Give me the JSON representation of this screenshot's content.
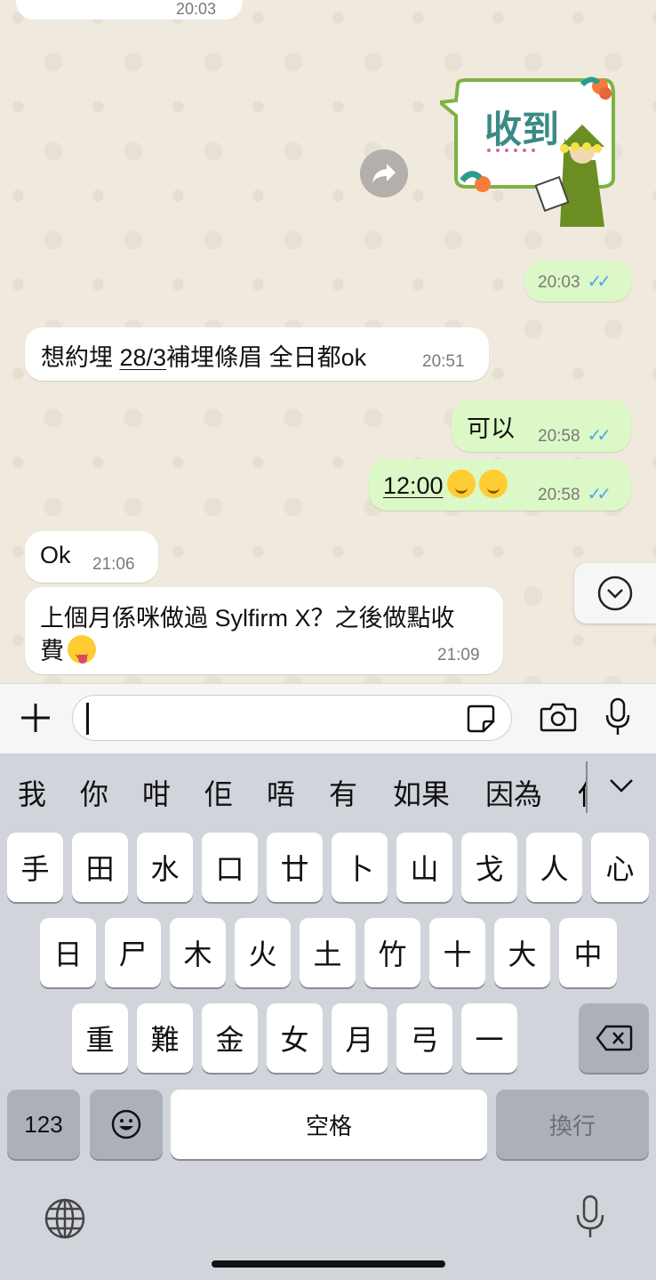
{
  "chat": {
    "top_time": "20:03",
    "sticker_text": "收到",
    "messages": [
      {
        "dir": "out",
        "time": "20:03"
      },
      {
        "dir": "in",
        "text_a": "想約埋 ",
        "text_link": "28/3",
        "text_b": "補埋條眉 全日都ok",
        "time": "20:51"
      },
      {
        "dir": "out",
        "text": "可以",
        "time": "20:58"
      },
      {
        "dir": "out",
        "text_link": "12:00",
        "time": "20:58"
      },
      {
        "dir": "in",
        "text": "Ok",
        "time": "21:06"
      },
      {
        "dir": "in",
        "line1": "上個月係咪做過 Sylfirm X？之後做點收",
        "line2": "費",
        "time": "21:09"
      }
    ]
  },
  "input": {
    "placeholder": ""
  },
  "keyboard": {
    "suggestions": [
      "我",
      "你",
      "咁",
      "佢",
      "唔",
      "有",
      "如果",
      "因為",
      "任"
    ],
    "row1": [
      "手",
      "田",
      "水",
      "口",
      "廿",
      "卜",
      "山",
      "戈",
      "人",
      "心"
    ],
    "row2": [
      "日",
      "尸",
      "木",
      "火",
      "土",
      "竹",
      "十",
      "大",
      "中"
    ],
    "row3": [
      "重",
      "難",
      "金",
      "女",
      "月",
      "弓",
      "一"
    ],
    "numbers_key": "123",
    "space_key": "空格",
    "return_key": "換行"
  },
  "colors": {
    "outgoing": "#dcf8c6",
    "incoming": "#ffffff",
    "ticks": "#4da8f0"
  },
  "icons": [
    "forward-icon",
    "chevron-down-icon",
    "plus-icon",
    "sticker-icon",
    "camera-icon",
    "microphone-icon",
    "chevron-down-icon",
    "backspace-icon",
    "emoji-icon",
    "globe-icon",
    "dictation-icon"
  ]
}
